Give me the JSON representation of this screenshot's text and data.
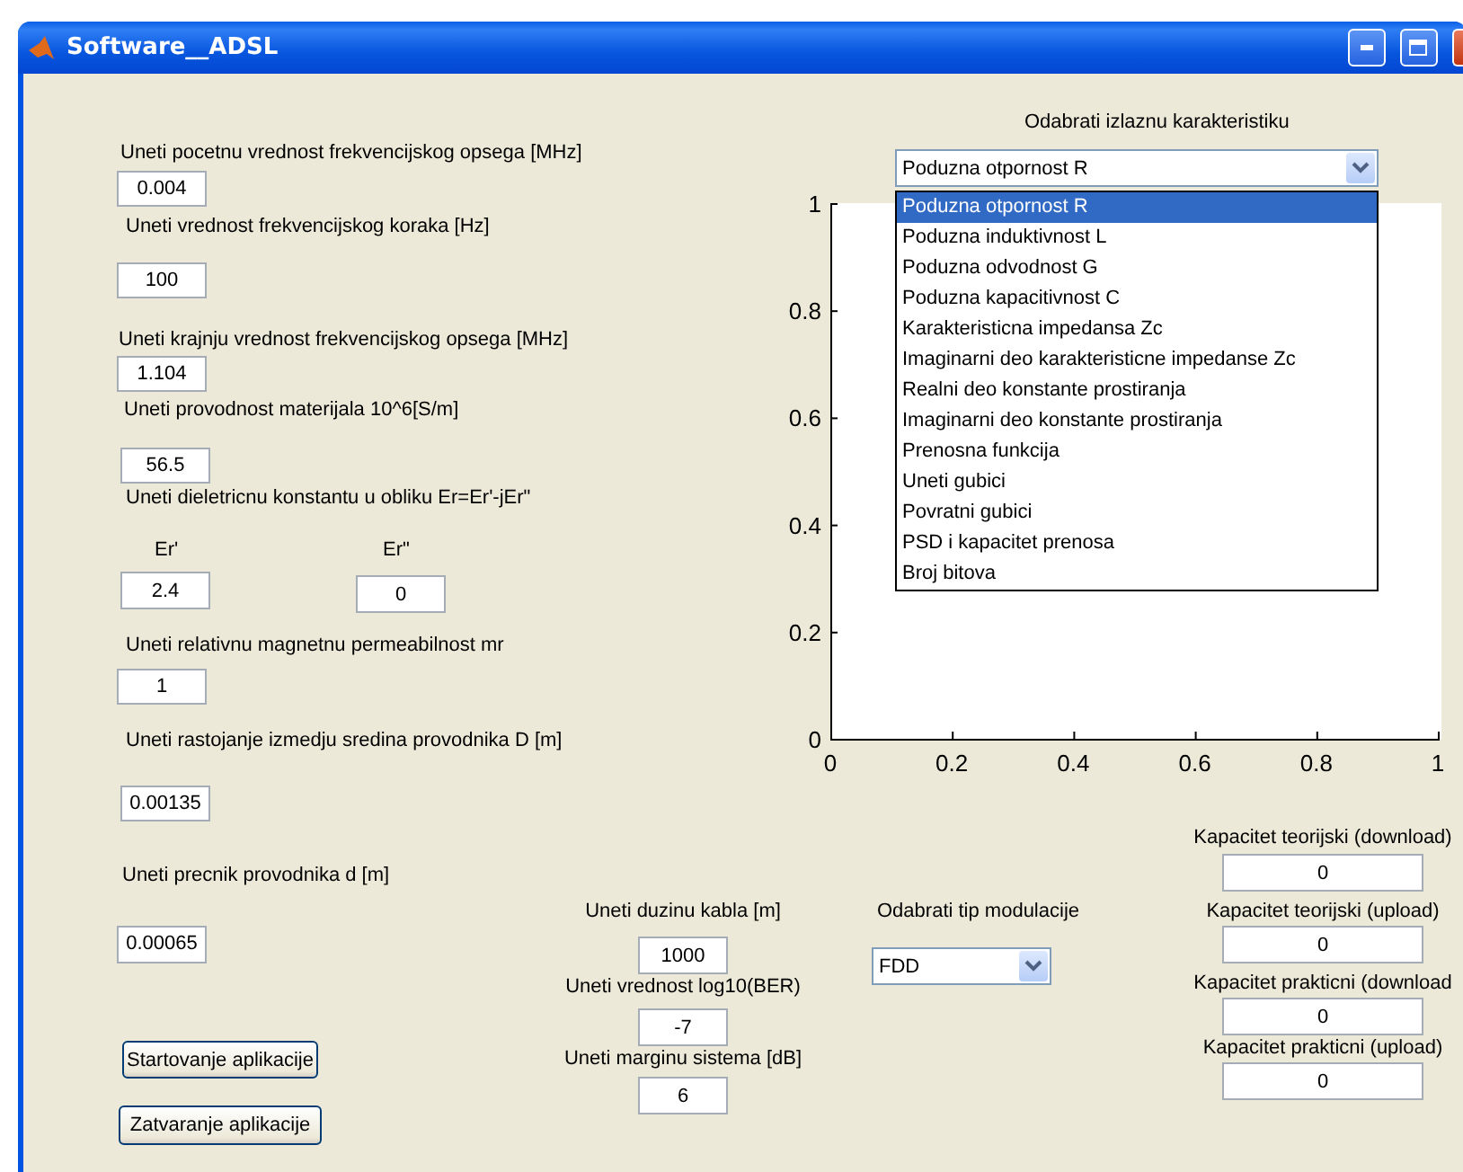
{
  "window": {
    "title": "Software__ADSL"
  },
  "parameters": [
    {
      "kind": "single",
      "label": "Uneti pocetnu vrednost frekvencijskog opsega [MHz]",
      "value": "0.004"
    },
    {
      "kind": "single",
      "label": "Uneti vrednost frekvencijskog koraka [Hz]",
      "value": "100"
    },
    {
      "kind": "single",
      "label": "Uneti krajnju vrednost frekvencijskog opsega [MHz]",
      "value": "1.104"
    },
    {
      "kind": "single",
      "label": "Uneti provodnost materijala 10^6[S/m]",
      "value": "56.5"
    },
    {
      "kind": "pair",
      "label": "Uneti dieletricnu konstantu u obliku Er=Er'-jEr\"",
      "fields": [
        {
          "label": "Er'",
          "value": "2.4"
        },
        {
          "label": "Er\"",
          "value": "0"
        }
      ]
    },
    {
      "kind": "single",
      "label": "Uneti relativnu magnetnu permeabilnost mr",
      "value": "1"
    },
    {
      "kind": "single",
      "label": "Uneti rastojanje izmedju sredina provodnika D [m]",
      "value": "0.00135"
    }
  ],
  "conductor_diameter": {
    "label": "Uneti precnik provodnika d [m]",
    "value": "0.00065"
  },
  "output_characteristic": {
    "label": "Odabrati izlaznu karakteristiku",
    "value": "Poduzna otpornost R",
    "expanded": true,
    "options": [
      {
        "label": "Poduzna otpornost R",
        "selected": true
      },
      {
        "label": "Poduzna induktivnost L",
        "selected": false
      },
      {
        "label": "Poduzna odvodnost G",
        "selected": false
      },
      {
        "label": "Poduzna kapacitivnost C",
        "selected": false
      },
      {
        "label": "Karakteristicna impedansa Zc",
        "selected": false
      },
      {
        "label": "Imaginarni deo karakteristicne impedanse Zc",
        "selected": false
      },
      {
        "label": "Realni deo konstante prostiranja",
        "selected": false
      },
      {
        "label": "Imaginarni deo konstante prostiranja",
        "selected": false
      },
      {
        "label": "Prenosna funkcija",
        "selected": false
      },
      {
        "label": "Uneti gubici",
        "selected": false
      },
      {
        "label": "Povratni gubici",
        "selected": false
      },
      {
        "label": "PSD i kapacitet prenosa",
        "selected": false
      },
      {
        "label": "Broj bitova",
        "selected": false
      }
    ]
  },
  "chart_data": {
    "type": "line",
    "xlim": [
      0,
      1
    ],
    "ylim": [
      0,
      1
    ],
    "xticks": [
      {
        "value": 0,
        "label": "0"
      },
      {
        "value": 0.2,
        "label": "0.2"
      },
      {
        "value": 0.4,
        "label": "0.4"
      },
      {
        "value": 0.6,
        "label": "0.6"
      },
      {
        "value": 0.8,
        "label": "0.8"
      },
      {
        "value": 1,
        "label": "1"
      }
    ],
    "yticks": [
      {
        "value": 0,
        "label": "0"
      },
      {
        "value": 0.2,
        "label": "0.2"
      },
      {
        "value": 0.4,
        "label": "0.4"
      },
      {
        "value": 0.6,
        "label": "0.6"
      },
      {
        "value": 0.8,
        "label": "0.8"
      },
      {
        "value": 1,
        "label": "1"
      }
    ]
  },
  "cable": [
    {
      "label": "Uneti duzinu kabla [m]",
      "value": "1000"
    },
    {
      "label": "Uneti vrednost log10(BER)",
      "value": "-7"
    },
    {
      "label": "Uneti marginu sistema [dB]",
      "value": "6"
    }
  ],
  "modulation": {
    "label": "Odabrati tip modulacije",
    "value": "FDD",
    "expanded": false
  },
  "capacity": [
    {
      "label": "Kapacitet teorijski (download)",
      "value": "0"
    },
    {
      "label": "Kapacitet teorijski (upload)",
      "value": "0"
    },
    {
      "label": "Kapacitet prakticni (download",
      "value": "0"
    },
    {
      "label": "Kapacitet prakticni (upload)",
      "value": "0"
    }
  ],
  "buttons": [
    "Startovanje aplikacije",
    "Zatvaranje aplikacije"
  ]
}
